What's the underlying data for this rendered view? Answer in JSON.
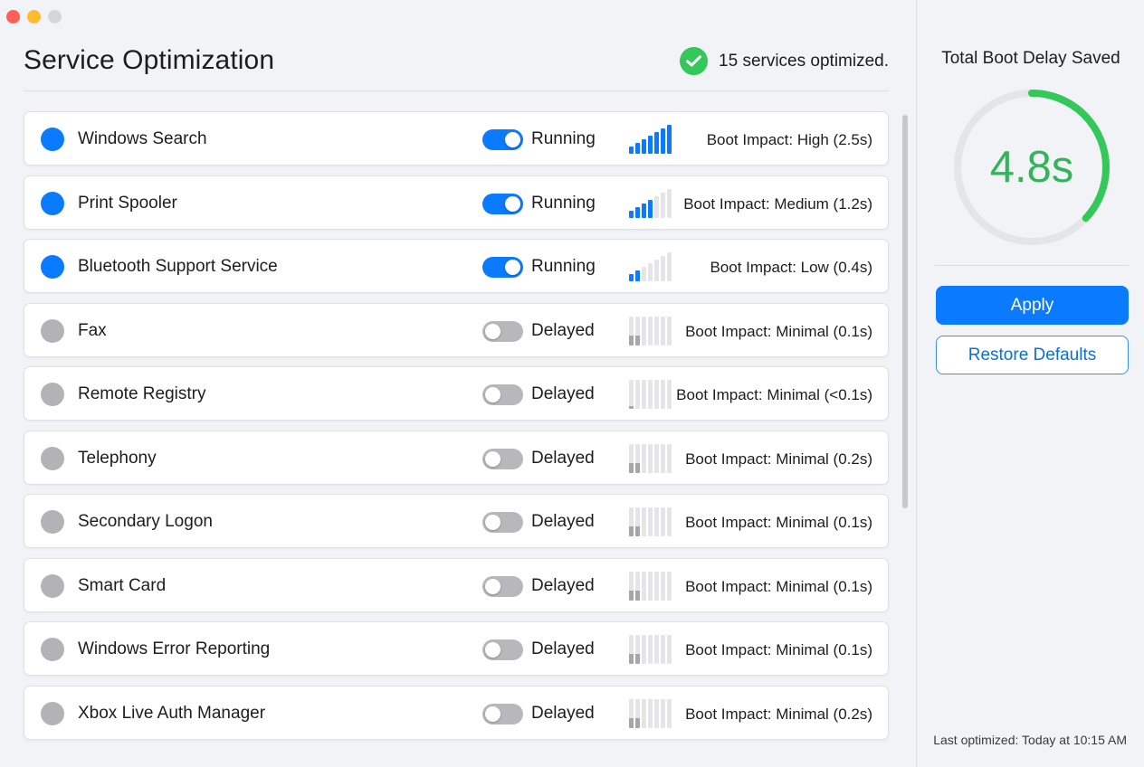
{
  "window": {
    "traffic_lights": [
      "close",
      "minimize",
      "zoom"
    ]
  },
  "header": {
    "title": "Service Optimization",
    "status_text": "15 services optimized.",
    "status_icon": "checkmark-circle-icon"
  },
  "colors": {
    "accent": "#0a7aff",
    "success": "#34c759",
    "running_dot": "#0a7aff",
    "delayed_dot": "#b3b3b7",
    "bar_active": "#0a7aff",
    "bar_inactive": "#e5e5e8",
    "bar_minimal": "#a6a6aa"
  },
  "services": [
    {
      "name": "Windows Search",
      "enabled": true,
      "status": "Running",
      "impact_level": 7,
      "impact_text": "Boot Impact: High (2.5s)"
    },
    {
      "name": "Print Spooler",
      "enabled": true,
      "status": "Running",
      "impact_level": 4,
      "impact_text": "Boot Impact: Medium (1.2s)"
    },
    {
      "name": "Bluetooth Support Service",
      "enabled": true,
      "status": "Running",
      "impact_level": 2,
      "impact_text": "Boot Impact: Low (0.4s)"
    },
    {
      "name": "Fax",
      "enabled": false,
      "status": "Delayed",
      "impact_level": 2,
      "impact_text": "Boot Impact: Minimal (0.1s)"
    },
    {
      "name": "Remote Registry",
      "enabled": false,
      "status": "Delayed",
      "impact_level": 1,
      "impact_text": "Boot Impact: Minimal (<0.1s)"
    },
    {
      "name": "Telephony",
      "enabled": false,
      "status": "Delayed",
      "impact_level": 2,
      "impact_text": "Boot Impact: Minimal (0.2s)"
    },
    {
      "name": "Secondary Logon",
      "enabled": false,
      "status": "Delayed",
      "impact_level": 2,
      "impact_text": "Boot Impact: Minimal (0.1s)"
    },
    {
      "name": "Smart Card",
      "enabled": false,
      "status": "Delayed",
      "impact_level": 2,
      "impact_text": "Boot Impact: Minimal (0.1s)"
    },
    {
      "name": "Windows Error Reporting",
      "enabled": false,
      "status": "Delayed",
      "impact_level": 2,
      "impact_text": "Boot Impact: Minimal (0.1s)"
    },
    {
      "name": "Xbox Live Auth Manager",
      "enabled": false,
      "status": "Delayed",
      "impact_level": 2,
      "impact_text": "Boot Impact: Minimal (0.2s)"
    }
  ],
  "sidebar": {
    "title": "Total Boot Delay Saved",
    "gauge_value": "4.8s",
    "gauge_fraction": 0.37,
    "apply_label": "Apply",
    "restore_label": "Restore Defaults",
    "last_optimized": "Last optimized: Today at 10:15 AM"
  }
}
